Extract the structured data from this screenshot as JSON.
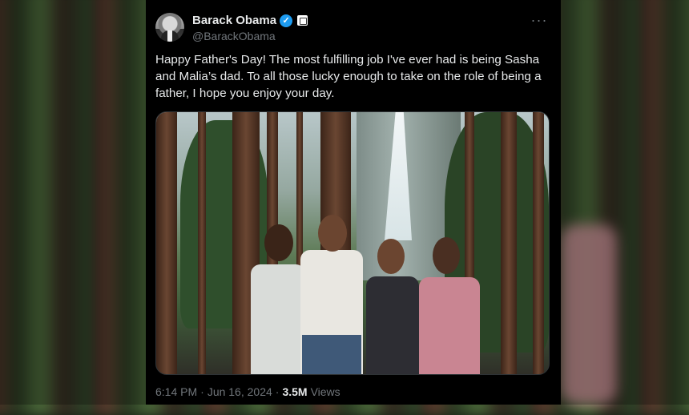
{
  "author": {
    "name": "Barack Obama",
    "handle": "@BarackObama",
    "verified_icon": "verified-badge-icon",
    "affiliation_icon": "government-affiliation-icon"
  },
  "more_label": "···",
  "tweet": {
    "text": "Happy Father's Day! The most fulfilling job I've ever had is being Sasha and Malia’s dad. To all those lucky enough to take on the role of being a father, I hope you enjoy your day."
  },
  "meta": {
    "time": "6:14 PM",
    "separator": "·",
    "date": "Jun 16, 2024",
    "views_count": "3.5M",
    "views_label": "Views"
  },
  "colors": {
    "background": "#000000",
    "text": "#e7e9ea",
    "muted": "#71767b",
    "verified": "#1d9bf0"
  }
}
